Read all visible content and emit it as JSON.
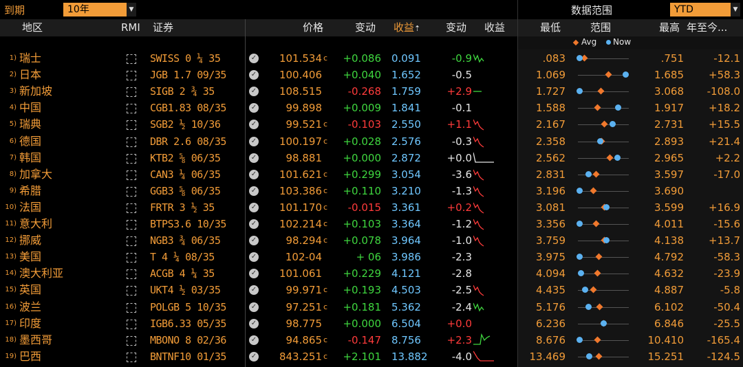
{
  "toolbar": {
    "maturity_label": "到期",
    "maturity_value": "10年",
    "data_range_label": "数据范围",
    "data_range_value": "YTD"
  },
  "headers": {
    "region": "地区",
    "rmi": "RMI",
    "security": "证券",
    "price": "价格",
    "change": "变动",
    "yield": "收益",
    "yield_change": "变动",
    "yield_chart": "收益",
    "low": "最低",
    "range": "范围",
    "high": "最高",
    "ytd": "年至今..."
  },
  "legend": {
    "avg": "Avg",
    "now": "Now"
  },
  "colors": {
    "orange": "#f29c38",
    "green": "#3fd73f",
    "red": "#ff3b3b",
    "blue": "#6fc7ff",
    "header_bg": "#1c1c1c"
  },
  "rows": [
    {
      "num": "1)",
      "name": "瑞士",
      "ticker": "SWISS 0 ¼ 35",
      "price": "101.534",
      "sfx": "c",
      "chg": "+0.086",
      "chg_dir": "pos",
      "yld": "0.091",
      "ychg": "-0.9",
      "ychg_dir": "pos",
      "spark": "green",
      "low": ".083",
      "high": ".751",
      "ytd": "-12.1",
      "avg": 0.12,
      "now": 0.03
    },
    {
      "num": "2)",
      "name": "日本",
      "ticker": "JGB 1.7 09/35",
      "price": "100.406",
      "sfx": "",
      "chg": "+0.040",
      "chg_dir": "pos",
      "yld": "1.652",
      "ychg": "-0.5",
      "ychg_dir": "neutral",
      "spark": "none",
      "low": "1.069",
      "high": "1.685",
      "ytd": "+58.3",
      "avg": 0.6,
      "now": 0.93
    },
    {
      "num": "3)",
      "name": "新加坡",
      "ticker": "SIGB 2 ¾ 35",
      "price": "108.515",
      "sfx": "",
      "chg": "-0.268",
      "chg_dir": "neg",
      "yld": "1.759",
      "ychg": "+2.9",
      "ychg_dir": "neg",
      "spark": "flat",
      "low": "1.727",
      "high": "3.068",
      "ytd": "-108.0",
      "avg": 0.45,
      "now": 0.03
    },
    {
      "num": "4)",
      "name": "中国",
      "ticker": "CGB1.83 08/35",
      "price": "99.898",
      "sfx": "",
      "chg": "+0.009",
      "chg_dir": "pos",
      "yld": "1.841",
      "ychg": "-0.1",
      "ychg_dir": "neutral",
      "spark": "none",
      "low": "1.588",
      "high": "1.917",
      "ytd": "+18.2",
      "avg": 0.38,
      "now": 0.78
    },
    {
      "num": "5)",
      "name": "瑞典",
      "ticker": "SGB2 ½ 10/36",
      "price": "99.521",
      "sfx": "c",
      "chg": "-0.103",
      "chg_dir": "neg",
      "yld": "2.550",
      "ychg": "+1.1",
      "ychg_dir": "neg",
      "spark": "red",
      "low": "2.167",
      "high": "2.731",
      "ytd": "+15.5",
      "avg": 0.52,
      "now": 0.68
    },
    {
      "num": "6)",
      "name": "德国",
      "ticker": "DBR 2.6 08/35",
      "price": "100.197",
      "sfx": "c",
      "chg": "+0.028",
      "chg_dir": "pos",
      "yld": "2.576",
      "ychg": "-0.3",
      "ychg_dir": "neutral",
      "spark": "red",
      "low": "2.358",
      "high": "2.893",
      "ytd": "+21.4",
      "avg": 0.46,
      "now": 0.43
    },
    {
      "num": "7)",
      "name": "韩国",
      "ticker": "KTB2 ⅝ 06/35",
      "price": "98.881",
      "sfx": "",
      "chg": "+0.000",
      "chg_dir": "pos",
      "yld": "2.872",
      "ychg": "+0.0",
      "ychg_dir": "neutral",
      "spark": "flatw",
      "low": "2.562",
      "high": "2.965",
      "ytd": "+2.2",
      "avg": 0.62,
      "now": 0.77
    },
    {
      "num": "8)",
      "name": "加拿大",
      "ticker": "CAN3 ¼ 06/35",
      "price": "101.621",
      "sfx": "c",
      "chg": "+0.299",
      "chg_dir": "pos",
      "yld": "3.054",
      "ychg": "-3.6",
      "ychg_dir": "neutral",
      "spark": "red",
      "low": "2.831",
      "high": "3.597",
      "ytd": "-17.0",
      "avg": 0.35,
      "now": 0.2
    },
    {
      "num": "9)",
      "name": "希腊",
      "ticker": "GGB3 ⅝ 06/35",
      "price": "103.386",
      "sfx": "c",
      "chg": "+0.110",
      "chg_dir": "pos",
      "yld": "3.210",
      "ychg": "-1.3",
      "ychg_dir": "neutral",
      "spark": "red",
      "low": "3.196",
      "high": "3.690",
      "ytd": "",
      "avg": 0.3,
      "now": 0.03
    },
    {
      "num": "10)",
      "name": "法国",
      "ticker": "FRTR 3 ½ 35",
      "price": "101.170",
      "sfx": "c",
      "chg": "-0.015",
      "chg_dir": "neg",
      "yld": "3.361",
      "ychg": "+0.2",
      "ychg_dir": "neg",
      "spark": "red",
      "low": "3.081",
      "high": "3.599",
      "ytd": "+16.9",
      "avg": 0.52,
      "now": 0.55
    },
    {
      "num": "11)",
      "name": "意大利",
      "ticker": "BTPS3.6 10/35",
      "price": "102.214",
      "sfx": "c",
      "chg": "+0.103",
      "chg_dir": "pos",
      "yld": "3.364",
      "ychg": "-1.2",
      "ychg_dir": "neutral",
      "spark": "red",
      "low": "3.356",
      "high": "4.011",
      "ytd": "-15.6",
      "avg": 0.35,
      "now": 0.03
    },
    {
      "num": "12)",
      "name": "挪威",
      "ticker": "NGB3 ¾ 06/35",
      "price": "98.294",
      "sfx": "c",
      "chg": "+0.078",
      "chg_dir": "pos",
      "yld": "3.964",
      "ychg": "-1.0",
      "ychg_dir": "neutral",
      "spark": "red",
      "low": "3.759",
      "high": "4.138",
      "ytd": "+13.7",
      "avg": 0.52,
      "now": 0.55
    },
    {
      "num": "13)",
      "name": "美国",
      "ticker": "T 4 ¼ 08/35",
      "price": "102-04",
      "sfx": "",
      "chg": "+ 06",
      "chg_dir": "pos",
      "yld": "3.986",
      "ychg": "-2.3",
      "ychg_dir": "neutral",
      "spark": "none",
      "low": "3.975",
      "high": "4.792",
      "ytd": "-58.3",
      "avg": 0.4,
      "now": 0.03
    },
    {
      "num": "14)",
      "name": "澳大利亚",
      "ticker": "ACGB 4 ¼ 35",
      "price": "101.061",
      "sfx": "",
      "chg": "+0.229",
      "chg_dir": "pos",
      "yld": "4.121",
      "ychg": "-2.8",
      "ychg_dir": "neutral",
      "spark": "none",
      "low": "4.094",
      "high": "4.632",
      "ytd": "-23.9",
      "avg": 0.38,
      "now": 0.06
    },
    {
      "num": "15)",
      "name": "英国",
      "ticker": "UKT4 ½ 03/35",
      "price": "99.971",
      "sfx": "c",
      "chg": "+0.193",
      "chg_dir": "pos",
      "yld": "4.503",
      "ychg": "-2.5",
      "ychg_dir": "neutral",
      "spark": "red",
      "low": "4.435",
      "high": "4.887",
      "ytd": "-5.8",
      "avg": 0.3,
      "now": 0.14
    },
    {
      "num": "16)",
      "name": "波兰",
      "ticker": "POLGB 5 10/35",
      "price": "97.251",
      "sfx": "c",
      "chg": "+0.181",
      "chg_dir": "pos",
      "yld": "5.362",
      "ychg": "-2.4",
      "ychg_dir": "neutral",
      "spark": "green",
      "low": "5.176",
      "high": "6.102",
      "ytd": "-50.4",
      "avg": 0.42,
      "now": 0.2
    },
    {
      "num": "17)",
      "name": "印度",
      "ticker": "IGB6.33 05/35",
      "price": "98.775",
      "sfx": "",
      "chg": "+0.000",
      "chg_dir": "pos",
      "yld": "6.504",
      "ychg": "+0.0",
      "ychg_dir": "neg",
      "spark": "none",
      "low": "6.236",
      "high": "6.846",
      "ytd": "-25.5",
      "avg": 0.5,
      "now": 0.5
    },
    {
      "num": "18)",
      "name": "墨西哥",
      "ticker": "MBONO 8 02/36",
      "price": "94.865",
      "sfx": "c",
      "chg": "-0.147",
      "chg_dir": "neg",
      "yld": "8.756",
      "ychg": "+2.3",
      "ychg_dir": "neg",
      "spark": "greenflat",
      "low": "8.676",
      "high": "10.410",
      "ytd": "-165.4",
      "avg": 0.38,
      "now": 0.03
    },
    {
      "num": "19)",
      "name": "巴西",
      "ticker": "BNTNF10 01/35",
      "price": "843.251",
      "sfx": "c",
      "chg": "+2.101",
      "chg_dir": "pos",
      "yld": "13.882",
      "ychg": "-4.0",
      "ychg_dir": "neutral",
      "spark": "redflat",
      "low": "13.469",
      "high": "15.251",
      "ytd": "-124.5",
      "avg": 0.4,
      "now": 0.22
    }
  ]
}
